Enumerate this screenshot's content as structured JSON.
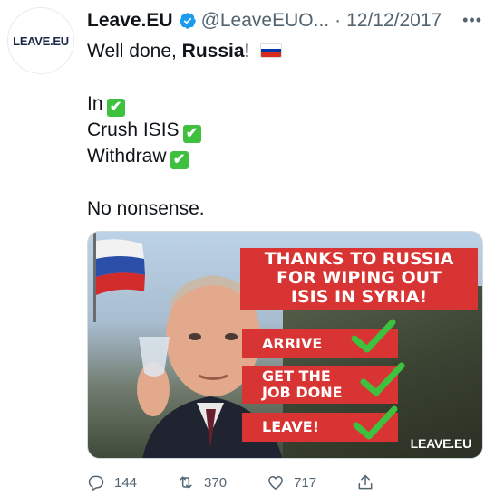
{
  "tweet": {
    "author_name": "Leave.EU",
    "handle": "@LeaveEUO...",
    "separator": "·",
    "date": "12/12/2017",
    "more_label": "•••",
    "avatar_text": "LEAVE.EU",
    "body": {
      "line1_prefix": "Well done, ",
      "line1_bold": "Russia",
      "line1_suffix": "!",
      "item1": "In",
      "item2": "Crush ISIS",
      "item3": "Withdraw",
      "closing": "No nonsense."
    },
    "check_glyph": "✔",
    "media": {
      "banner_line1": "THANKS TO RUSSIA",
      "banner_line2": "FOR WIPING OUT",
      "banner_line3": "ISIS IN SYRIA!",
      "step1": "ARRIVE",
      "step2_line1": "GET THE",
      "step2_line2": "JOB DONE",
      "step3": "LEAVE!",
      "logo_text": "LEAVE.EU"
    },
    "actions": {
      "replies": "144",
      "retweets": "370",
      "likes": "717"
    }
  },
  "colors": {
    "verified": "#1d9bf0",
    "text": "#0f1419",
    "muted": "#536471",
    "banner_red": "#d93434",
    "check_green": "#3ec13e"
  },
  "icons": [
    "verified-badge-icon",
    "more-options-icon",
    "reply-icon",
    "retweet-icon",
    "like-icon",
    "share-icon",
    "russia-flag-icon",
    "check-mark-icon"
  ]
}
